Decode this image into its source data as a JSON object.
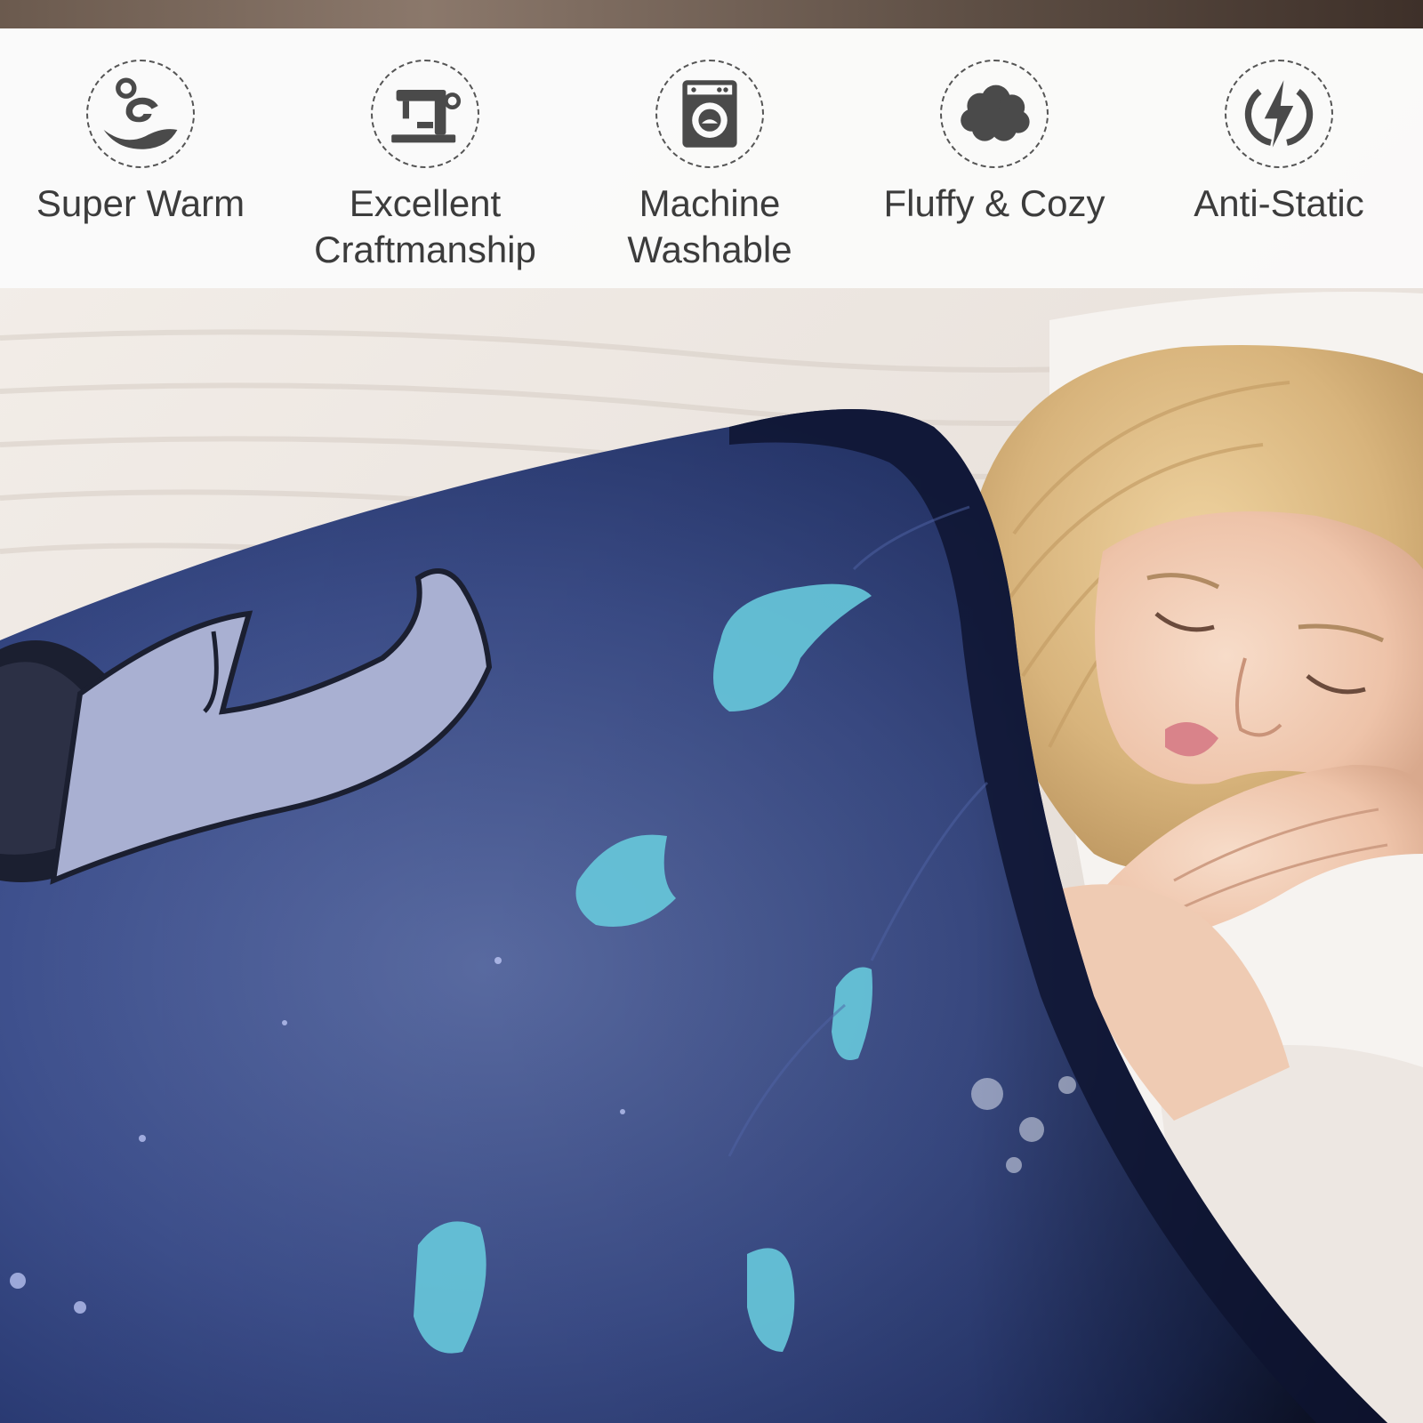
{
  "features": [
    {
      "label": "Super Warm",
      "icon": "warm-wave-icon"
    },
    {
      "label": "Excellent\nCraftmanship",
      "icon": "sewing-machine-icon"
    },
    {
      "label": "Machine\nWashable",
      "icon": "washing-machine-icon"
    },
    {
      "label": "Fluffy & Cozy",
      "icon": "cloud-icon"
    },
    {
      "label": "Anti-Static",
      "icon": "lightning-icon"
    }
  ],
  "colors": {
    "icon_gray": "#4a4a4a",
    "blanket_navy": "#1f2f5c",
    "blanket_light": "#4a5d96",
    "accent_cyan": "#63c6d8",
    "hair_blond": "#d9b57f",
    "skin": "#f1cbb4"
  }
}
